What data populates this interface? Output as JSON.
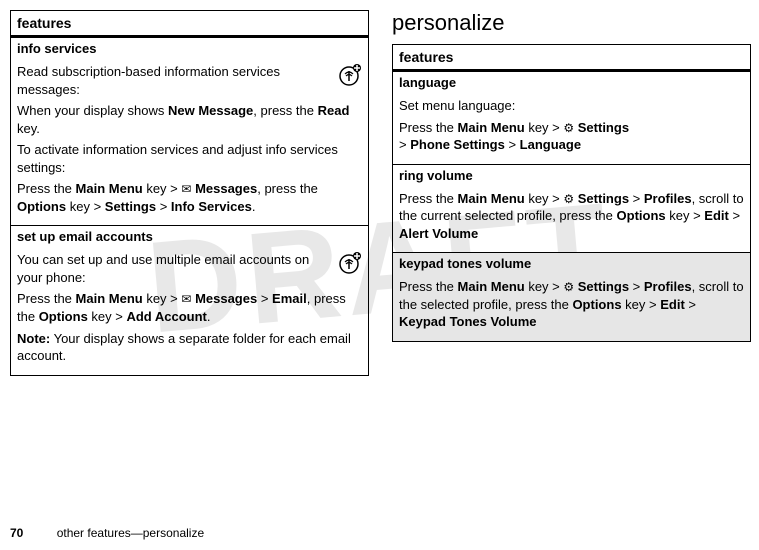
{
  "watermark": "DRAFT",
  "left": {
    "header": "features",
    "info_services": {
      "title": "info services",
      "p1": "Read subscription-based information services messages:",
      "p2a": "When your display shows ",
      "p2_new": "New Message",
      "p2b": ", press the ",
      "p2_read": "Read",
      "p2c": " key.",
      "p3": "To activate information services and adjust info services settings:",
      "p4a": "Press the ",
      "p4_main": "Main Menu",
      "p4b": " key > ",
      "p4_msgs": "Messages",
      "p4c": ", press the ",
      "p4_opt": "Options",
      "p4d": " key > ",
      "p4_set": "Settings",
      "p4e": " > ",
      "p4_info": "Info Services",
      "p4f": "."
    },
    "email": {
      "title": "set up email accounts",
      "p1": "You can set up and use multiple email accounts on your phone:",
      "p2a": "Press the ",
      "p2_main": "Main Menu",
      "p2b": " key > ",
      "p2_msgs": "Messages",
      "p2c": " > ",
      "p2_email": "Email",
      "p2d": ", press the ",
      "p2_opt": "Options",
      "p2e": " key > ",
      "p2_add": "Add Account",
      "p2f": ".",
      "note_label": "Note:",
      "note": " Your display shows a separate folder for each email account."
    }
  },
  "right": {
    "heading": "personalize",
    "header": "features",
    "language": {
      "title": "language",
      "p1": "Set menu language:",
      "p2a": "Press the ",
      "p2_main": "Main Menu",
      "p2b": " key > ",
      "p2_set": "Settings",
      "p2c": " > ",
      "p2_phone": "Phone Settings",
      "p2d": " > ",
      "p2_lang": "Language"
    },
    "ring": {
      "title": "ring volume",
      "p1a": "Press the ",
      "p1_main": "Main Menu",
      "p1b": " key > ",
      "p1_set": "Settings",
      "p1c": " > ",
      "p1_prof": "Profiles",
      "p1d": ", scroll to the current selected profile, press the ",
      "p1_opt": "Options",
      "p1e": " key > ",
      "p1_edit": "Edit",
      "p1f": " > ",
      "p1_alert": "Alert Volume"
    },
    "keypad": {
      "title": "keypad tones volume",
      "p1a": "Press the ",
      "p1_main": "Main Menu",
      "p1b": " key > ",
      "p1_set": "Settings",
      "p1c": " > ",
      "p1_prof": "Profiles",
      "p1d": ", scroll to the selected profile, press the ",
      "p1_opt": "Options",
      "p1e": " key > ",
      "p1_edit": "Edit",
      "p1f": " > ",
      "p1_kvol": "Keypad Tones Volume"
    }
  },
  "footer": {
    "page": "70",
    "text": "other features—personalize"
  },
  "icons": {
    "envelope": "✉",
    "settings": "⚙"
  }
}
